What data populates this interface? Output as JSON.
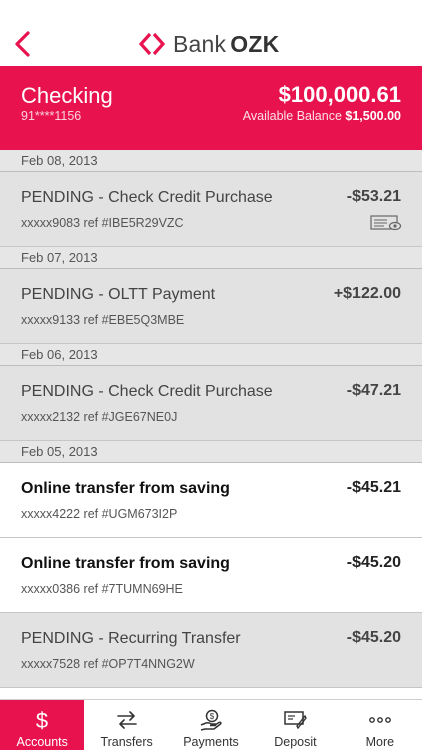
{
  "header": {
    "back_icon": "chevron-left-icon",
    "logo_bank": "Bank",
    "logo_ozk": "OZK",
    "brand_color": "#e8134e"
  },
  "account": {
    "name": "Checking",
    "number": "91****1156",
    "balance": "$100,000.61",
    "available_label": "Available Balance",
    "available_amount": "$1,500.00"
  },
  "groups": [
    {
      "date": "Feb 08, 2013",
      "transactions": [
        {
          "description": "PENDING - Check Credit Purchase",
          "ref": "xxxxx9083 ref #IBE5R29VZC",
          "amount": "-$53.21",
          "status": "pending",
          "icon": "check-image-icon"
        }
      ]
    },
    {
      "date": "Feb 07, 2013",
      "transactions": [
        {
          "description": "PENDING - OLTT Payment",
          "ref": "xxxxx9133 ref #EBE5Q3MBE",
          "amount": "+$122.00",
          "status": "pending"
        }
      ]
    },
    {
      "date": "Feb 06, 2013",
      "transactions": [
        {
          "description": "PENDING - Check Credit Purchase",
          "ref": "xxxxx2132 ref #JGE67NE0J",
          "amount": "-$47.21",
          "status": "pending"
        }
      ]
    },
    {
      "date": "Feb 05, 2013",
      "transactions": [
        {
          "description": "Online transfer from saving",
          "ref": "xxxxx4222 ref #UGM673I2P",
          "amount": "-$45.21",
          "status": "posted"
        },
        {
          "description": "Online transfer from saving",
          "ref": "xxxxx0386 ref #7TUMN69HE",
          "amount": "-$45.20",
          "status": "posted"
        },
        {
          "description": "PENDING - Recurring Transfer",
          "ref": "xxxxx7528 ref #OP7T4NNG2W",
          "amount": "-$45.20",
          "status": "pending"
        }
      ]
    }
  ],
  "tabs": [
    {
      "label": "Accounts",
      "icon": "dollar-icon",
      "active": true
    },
    {
      "label": "Transfers",
      "icon": "transfer-arrows-icon",
      "active": false
    },
    {
      "label": "Payments",
      "icon": "payment-hand-icon",
      "active": false
    },
    {
      "label": "Deposit",
      "icon": "deposit-check-icon",
      "active": false
    },
    {
      "label": "More",
      "icon": "more-dots-icon",
      "active": false
    }
  ]
}
